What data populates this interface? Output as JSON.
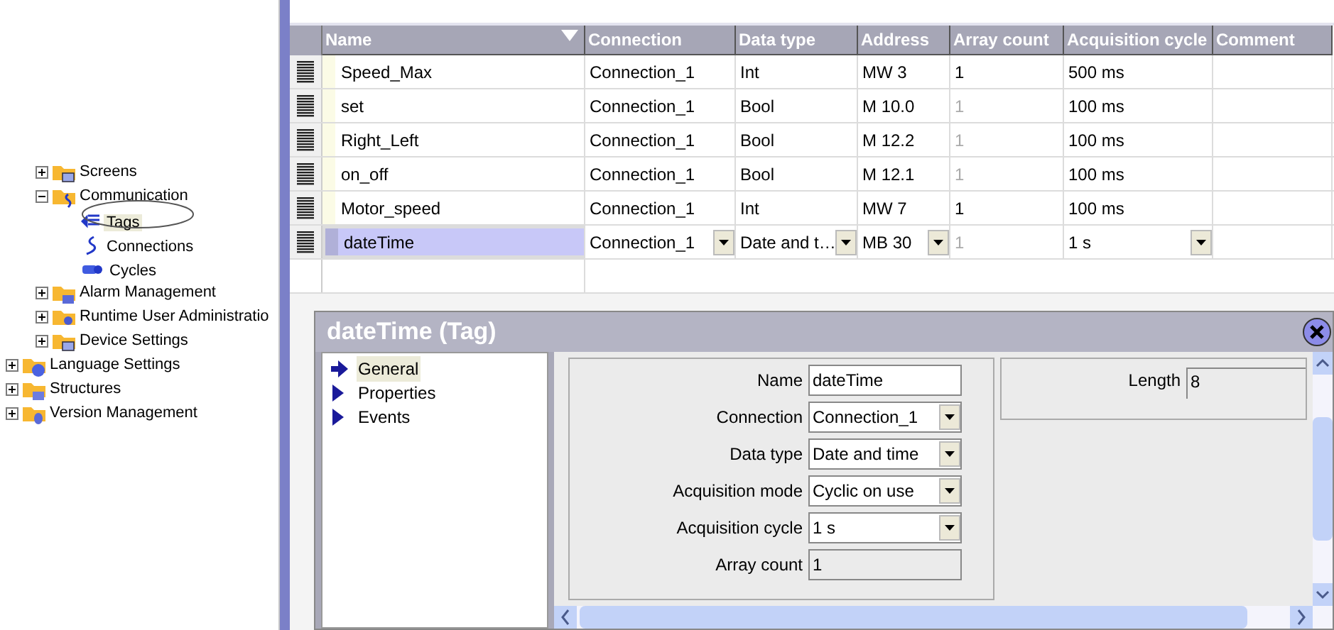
{
  "tree": [
    {
      "children": [
        {
          "label": "Screens",
          "expanded": false
        },
        {
          "label": "Communication",
          "expanded": true,
          "children": [
            {
              "label": "Tags",
              "selected": true
            },
            {
              "label": "Connections",
              "selected": false
            },
            {
              "label": "Cycles",
              "selected": false
            }
          ]
        },
        {
          "label": "Alarm Management",
          "expanded": false
        },
        {
          "label": "Runtime User Administratio",
          "expanded": false
        },
        {
          "label": "Device Settings",
          "expanded": false
        }
      ]
    },
    {
      "label": "Language Settings",
      "expanded": false
    },
    {
      "label": "Structures",
      "expanded": false
    },
    {
      "label": "Version Management",
      "expanded": false
    }
  ],
  "table": {
    "columns": [
      "Name",
      "Connection",
      "Data type",
      "Address",
      "Array count",
      "Acquisition cycle",
      "Comment"
    ],
    "rows": [
      {
        "selected": false,
        "editing": false,
        "cells": [
          "Speed_Max",
          "Connection_1",
          "Int",
          "MW 3",
          "1",
          "500 ms"
        ],
        "array_count_disabled": false
      },
      {
        "selected": false,
        "editing": false,
        "cells": [
          "set",
          "Connection_1",
          "Bool",
          "M 10.0",
          "1",
          "100 ms"
        ],
        "array_count_disabled": true
      },
      {
        "selected": false,
        "editing": false,
        "cells": [
          "Right_Left",
          "Connection_1",
          "Bool",
          "M 12.2",
          "1",
          "100 ms"
        ],
        "array_count_disabled": true
      },
      {
        "selected": false,
        "editing": false,
        "cells": [
          "on_off",
          "Connection_1",
          "Bool",
          "M 12.1",
          "1",
          "100 ms"
        ],
        "array_count_disabled": true
      },
      {
        "selected": false,
        "editing": false,
        "cells": [
          "Motor_speed",
          "Connection_1",
          "Int",
          "MW 7",
          "1",
          "100 ms"
        ],
        "array_count_disabled": false
      },
      {
        "selected": true,
        "editing": true,
        "cells": [
          "dateTime",
          "Connection_1",
          "Date and t…",
          "MB 30",
          "1",
          "1 s"
        ],
        "array_count_disabled": true
      }
    ]
  },
  "dialog": {
    "title": "dateTime (Tag)",
    "nav": [
      {
        "label": "General",
        "selected": true
      },
      {
        "label": "Properties",
        "selected": false
      },
      {
        "label": "Events",
        "selected": false
      }
    ],
    "fields": [
      {
        "label": "Name",
        "kind": "text",
        "value": "dateTime"
      },
      {
        "label": "Connection",
        "kind": "select",
        "value": "Connection_1"
      },
      {
        "label": "Data type",
        "kind": "select",
        "value": "Date and time"
      },
      {
        "label": "Acquisition mode",
        "kind": "select",
        "value": "Cyclic on use"
      },
      {
        "label": "Acquisition cycle",
        "kind": "select",
        "value": "1 s"
      },
      {
        "label": "Array count",
        "kind": "readonly",
        "value": "1"
      }
    ],
    "length": {
      "label": "Length",
      "value": "8"
    }
  }
}
